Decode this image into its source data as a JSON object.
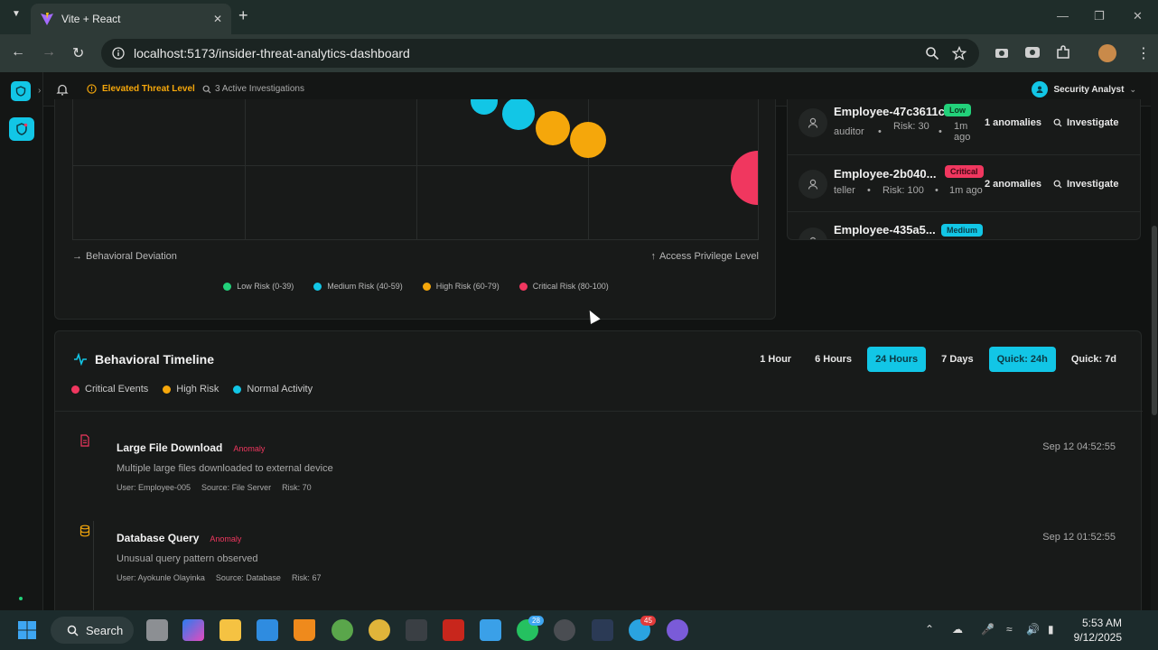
{
  "browser": {
    "tab_title": "Vite + React",
    "url": "localhost:5173/insider-threat-analytics-dashboard"
  },
  "topbar": {
    "threat_level": "Elevated Threat Level",
    "investigations": "3 Active Investigations",
    "user_role": "Security Analyst"
  },
  "scatter": {
    "x_axis_label": "Behavioral Deviation",
    "y_axis_label": "Access Privilege Level",
    "legend": [
      {
        "label": "Low Risk (0-39)",
        "color": "#22d17a"
      },
      {
        "label": "Medium Risk (40-59)",
        "color": "#12c6e6"
      },
      {
        "label": "High Risk (60-79)",
        "color": "#f5a70b"
      },
      {
        "label": "Critical Risk (80-100)",
        "color": "#f0375f"
      }
    ]
  },
  "employees": [
    {
      "name": "Employee-47c3611c",
      "badge": "Low",
      "badge_color": "#22d17a",
      "role": "auditor",
      "risk": "Risk: 30",
      "time": "1m ago",
      "anomalies": "1 anomalies",
      "action": "Investigate"
    },
    {
      "name": "Employee-2b040...",
      "badge": "Critical",
      "badge_color": "#f0375f",
      "role": "teller",
      "risk": "Risk: 100",
      "time": "1m ago",
      "anomalies": "2 anomalies",
      "action": "Investigate"
    },
    {
      "name": "Employee-435a5...",
      "badge": "Medium",
      "badge_color": "#12c6e6"
    }
  ],
  "timeline": {
    "title": "Behavioral Timeline",
    "legend": [
      {
        "label": "Critical Events",
        "color": "#f0375f"
      },
      {
        "label": "High Risk",
        "color": "#f5a70b"
      },
      {
        "label": "Normal Activity",
        "color": "#12c6e6"
      }
    ],
    "ranges": [
      {
        "label": "1 Hour",
        "active": false
      },
      {
        "label": "6 Hours",
        "active": false
      },
      {
        "label": "24 Hours",
        "active": true
      },
      {
        "label": "7 Days",
        "active": false
      },
      {
        "label": "Quick: 24h",
        "active": true
      },
      {
        "label": "Quick: 7d",
        "active": false
      }
    ],
    "events": [
      {
        "icon": "file-icon",
        "icon_color": "#f0375f",
        "title": "Large File Download",
        "tag": "Anomaly",
        "description": "Multiple large files downloaded to external device",
        "user": "User: Employee-005",
        "source": "Source: File Server",
        "risk": "Risk: 70",
        "time": "Sep 12 04:52:55"
      },
      {
        "icon": "database-icon",
        "icon_color": "#f5a70b",
        "title": "Database Query",
        "tag": "Anomaly",
        "description": "Unusual query pattern observed",
        "user": "User: Ayokunle Olayinka",
        "source": "Source: Database",
        "risk": "Risk: 67",
        "time": "Sep 12 01:52:55"
      }
    ]
  },
  "taskbar": {
    "search_label": "Search",
    "whatsapp_badge": "28",
    "telegram_badge": "45",
    "time": "5:53 AM",
    "date": "9/12/2025"
  }
}
